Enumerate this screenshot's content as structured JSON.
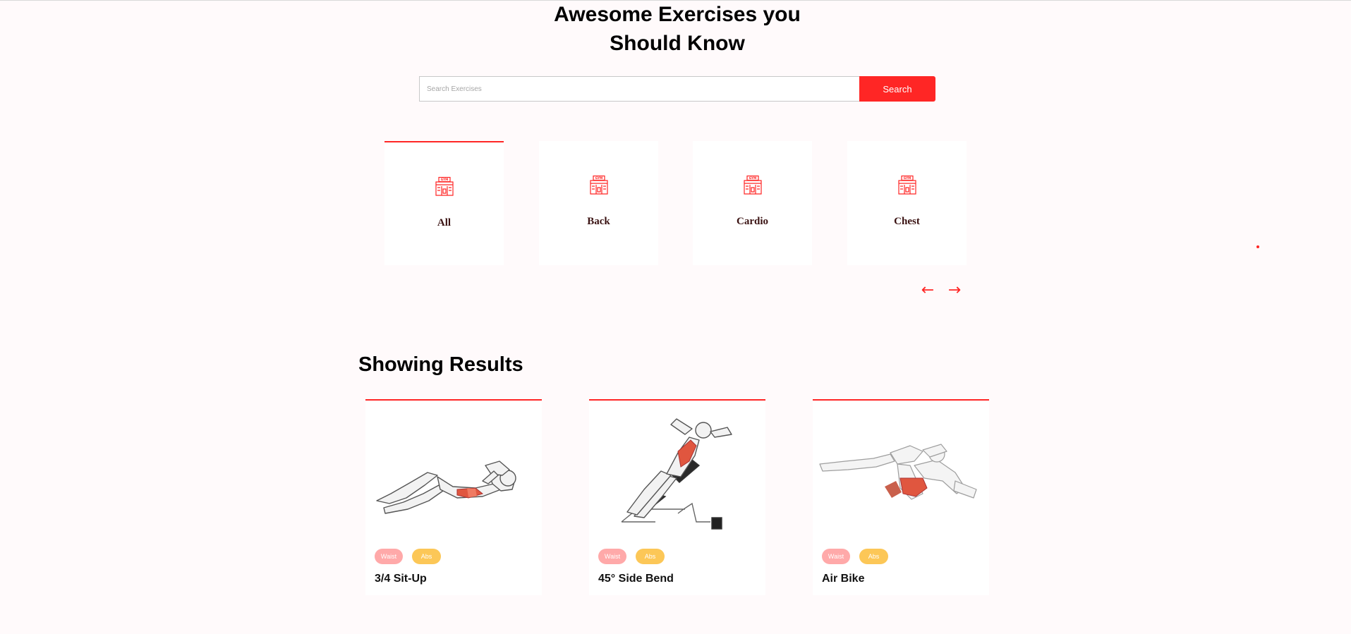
{
  "hero": {
    "title_line1": "Awesome Exercises you",
    "title_line2": "Should Know"
  },
  "search": {
    "placeholder": "Search Exercises",
    "value": "",
    "button_label": "Search"
  },
  "categories": {
    "icon": "gym-icon",
    "active": "All",
    "items": [
      {
        "label": "All"
      },
      {
        "label": "Back"
      },
      {
        "label": "Cardio"
      },
      {
        "label": "Chest"
      }
    ]
  },
  "carousel": {
    "prev_label": "←",
    "next_label": "→"
  },
  "results": {
    "heading": "Showing Results",
    "cards": [
      {
        "name": "3/4 Sit-Up",
        "tags": [
          "Waist",
          "Abs"
        ],
        "image": "sit-up-illustration"
      },
      {
        "name": "45° Side Bend",
        "tags": [
          "Waist",
          "Abs"
        ],
        "image": "side-bend-illustration"
      },
      {
        "name": "Air Bike",
        "tags": [
          "Waist",
          "Abs"
        ],
        "image": "air-bike-illustration"
      }
    ]
  },
  "colors": {
    "accent": "#ff2625",
    "tag_waist": "#ffa9a9",
    "tag_abs": "#fcc757",
    "background": "#fffafb",
    "muscle_highlight": "#e0563f"
  }
}
